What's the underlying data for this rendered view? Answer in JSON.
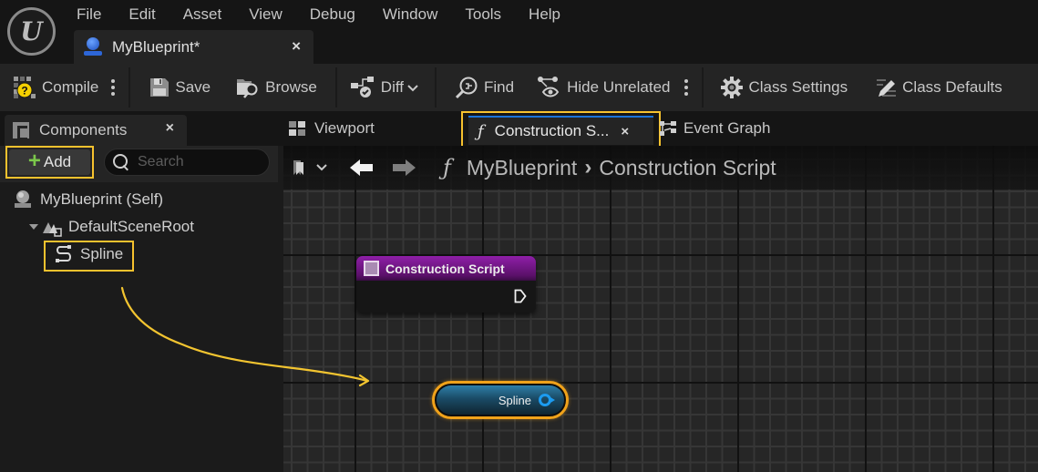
{
  "app": {
    "logo": "U",
    "menu": [
      "File",
      "Edit",
      "Asset",
      "View",
      "Debug",
      "Window",
      "Tools",
      "Help"
    ],
    "document_tab": {
      "title": "MyBlueprint*",
      "close": "×"
    }
  },
  "toolbar": {
    "compile": "Compile",
    "save": "Save",
    "browse": "Browse",
    "diff": "Diff",
    "find": "Find",
    "hide_unrelated": "Hide Unrelated",
    "class_settings": "Class Settings",
    "class_defaults": "Class Defaults",
    "compile_status_badge": "?"
  },
  "components_panel": {
    "tab_label": "Components",
    "close": "×",
    "add_label": "Add",
    "search_placeholder": "Search",
    "tree": [
      {
        "label": "MyBlueprint (Self)",
        "depth": 0,
        "icon": "actor-icon"
      },
      {
        "label": "DefaultSceneRoot",
        "depth": 1,
        "icon": "scene-root-icon",
        "expanded": true
      },
      {
        "label": "Spline",
        "depth": 2,
        "icon": "spline-icon",
        "highlighted": true
      }
    ]
  },
  "graph_tabs": [
    {
      "label": "Viewport",
      "icon": "viewport-icon",
      "active": false
    },
    {
      "label": "Construction S...",
      "icon": "function-icon",
      "active": true,
      "close": "×"
    },
    {
      "label": "Event Graph",
      "icon": "event-graph-icon",
      "active": false
    }
  ],
  "graph_header": {
    "breadcrumb": [
      "MyBlueprint",
      "Construction Script"
    ],
    "separator": "›",
    "function_glyph": "ƒ"
  },
  "nodes": {
    "construction_script": {
      "title": "Construction Script"
    },
    "spline_getter": {
      "label": "Spline"
    }
  },
  "colors": {
    "highlight_outline": "#f7c22e",
    "node_purple": "#8f1fa8",
    "object_pin_blue": "#1c9bf0",
    "selected_node_orange": "#f0a21a",
    "add_plus_green": "#7cc84b",
    "active_tab_accent": "#1a73d9"
  }
}
